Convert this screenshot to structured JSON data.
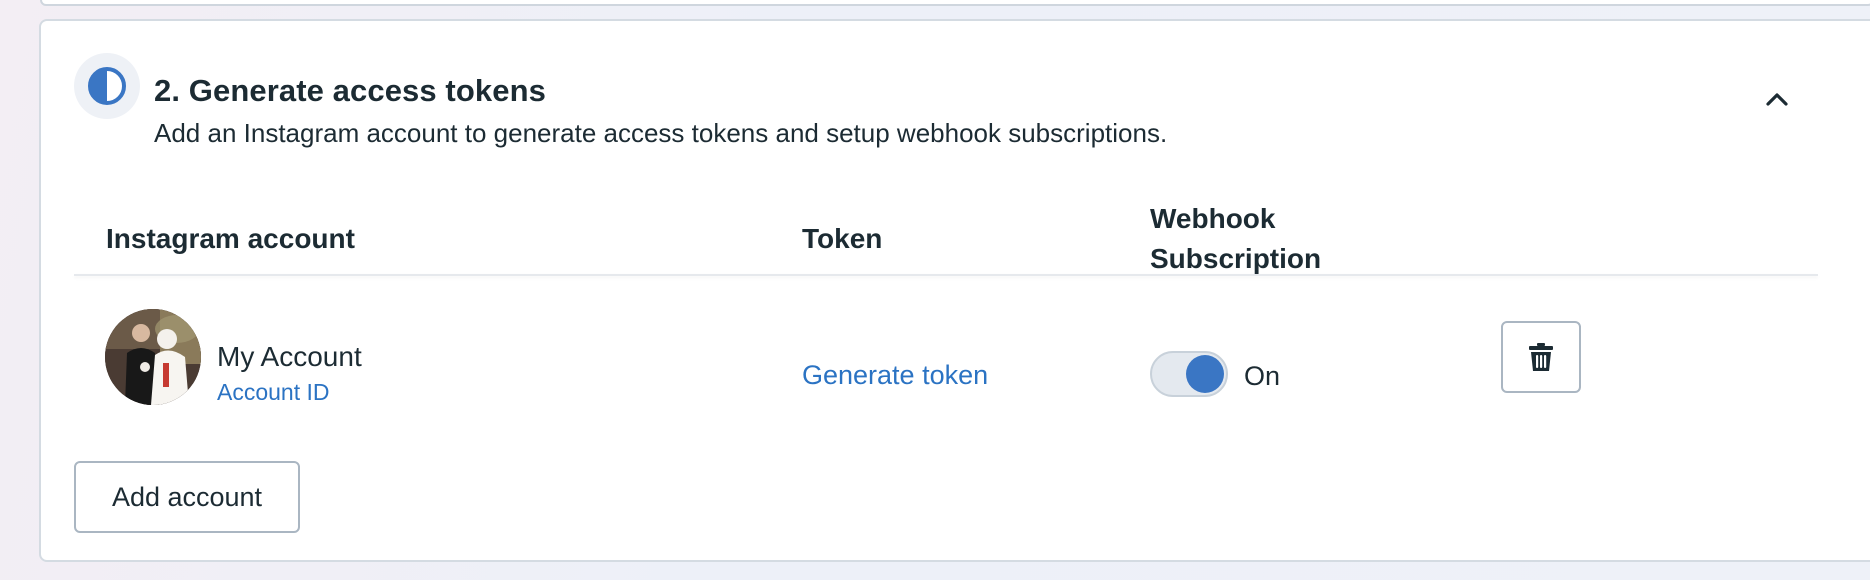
{
  "step": {
    "title": "2. Generate access tokens",
    "description": "Add an Instagram account to generate access tokens and setup webhook subscriptions.",
    "status_icon": "half-circle-progress-icon",
    "collapse_icon": "chevron-up-icon"
  },
  "table": {
    "columns": [
      "Instagram account",
      "Token",
      "Webhook Subscription"
    ],
    "rows": [
      {
        "account_name": "My Account",
        "account_id_link": "Account ID",
        "token_action": "Generate token",
        "webhook_state": "On",
        "delete_icon": "trash-icon"
      }
    ]
  },
  "actions": {
    "add_account": "Add account"
  },
  "colors": {
    "accent": "#3a76c4",
    "link": "#2b73c3",
    "text": "#1c2b33",
    "border": "#aab6c2"
  }
}
